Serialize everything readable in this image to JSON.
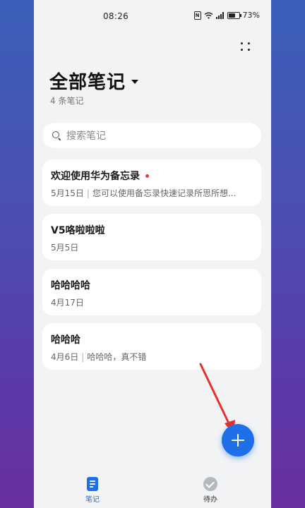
{
  "status_bar": {
    "time": "08:26",
    "battery": "73%"
  },
  "header": {
    "title": "全部笔记",
    "count": "4 条笔记"
  },
  "search": {
    "placeholder": "搜索笔记"
  },
  "notes": [
    {
      "title": "欢迎使用华为备忘录",
      "date": "5月15日",
      "preview": "您可以使用备忘录快速记录所思所想...",
      "unread": true
    },
    {
      "title": "V5咯啦啦啦",
      "date": "5月5日",
      "preview": ""
    },
    {
      "title": "哈哈哈哈",
      "date": "4月17日",
      "preview": ""
    },
    {
      "title": "哈哈哈",
      "date": "4月6日",
      "preview": "哈哈哈，真不错"
    }
  ],
  "bottom_nav": [
    {
      "label": "笔记",
      "icon": "notes-icon",
      "active": true
    },
    {
      "label": "待办",
      "icon": "check-circle-icon",
      "active": false
    }
  ],
  "colors": {
    "accent": "#1f6fe8",
    "unread_dot": "#e0403a",
    "annotation_arrow": "#e8302a"
  }
}
